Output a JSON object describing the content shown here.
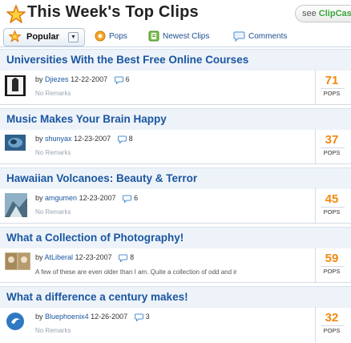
{
  "header": {
    "title": "This Week's Top Clips",
    "see_prefix": "see ",
    "see_brand": "ClipCast"
  },
  "tabs": [
    {
      "label": "Popular",
      "icon": "star-icon",
      "active": true
    },
    {
      "label": "Pops",
      "icon": "pops-icon"
    },
    {
      "label": "Newest Clips",
      "icon": "clips-icon"
    },
    {
      "label": "Comments",
      "icon": "comment-icon"
    }
  ],
  "clips": [
    {
      "title": "Universities With the Best Free Online Courses",
      "by": "by",
      "user": "Djiezes",
      "date": "12-22-2007",
      "comments": "6",
      "remarks": "No Remarks",
      "pops": "71",
      "pops_label": "POPS"
    },
    {
      "title": "Music Makes Your Brain Happy",
      "by": "by",
      "user": "shunyax",
      "date": "12-23-2007",
      "comments": "8",
      "remarks": "No Remarks",
      "pops": "37",
      "pops_label": "POPS"
    },
    {
      "title": "Hawaiian Volcanoes: Beauty & Terror",
      "by": "by",
      "user": "amgumen",
      "date": "12-23-2007",
      "comments": "6",
      "remarks": "No Remarks",
      "pops": "45",
      "pops_label": "POPS"
    },
    {
      "title": "What a Collection of Photography!",
      "by": "by",
      "user": "AtLiberal",
      "date": "12-23-2007",
      "comments": "8",
      "remarks": "A few of these are even older than I am. Quite a collection of odd and ir",
      "pops": "59",
      "pops_label": "POPS"
    },
    {
      "title": "What a difference a century makes!",
      "by": "by",
      "user": "Bluephoenix4",
      "date": "12-26-2007",
      "comments": "3",
      "remarks": "No Remarks",
      "pops": "32",
      "pops_label": "POPS"
    }
  ],
  "colors": {
    "accent": "#f08a10",
    "link": "#1a56a0",
    "brand": "#39a53a"
  }
}
